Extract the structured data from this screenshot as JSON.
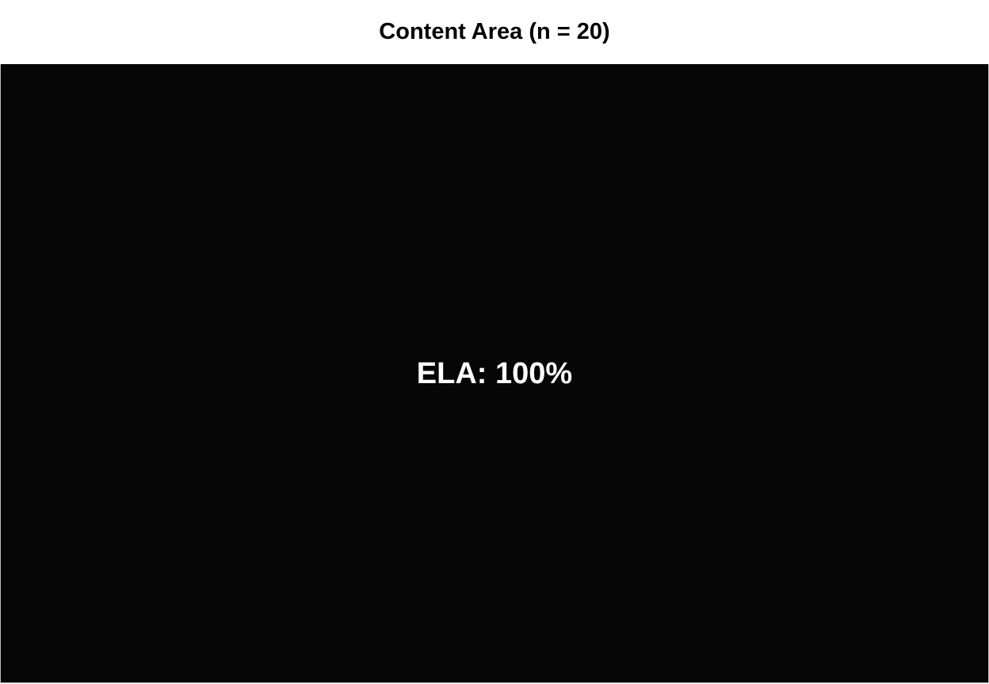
{
  "chart_data": {
    "type": "heatmap",
    "title": "Content Area (n = 20)",
    "cells": [
      {
        "label": "ELA: 100%",
        "category": "ELA",
        "value": 100
      }
    ],
    "colors": {
      "cell_fill": "#060606",
      "label_text": "#ffffff"
    }
  }
}
